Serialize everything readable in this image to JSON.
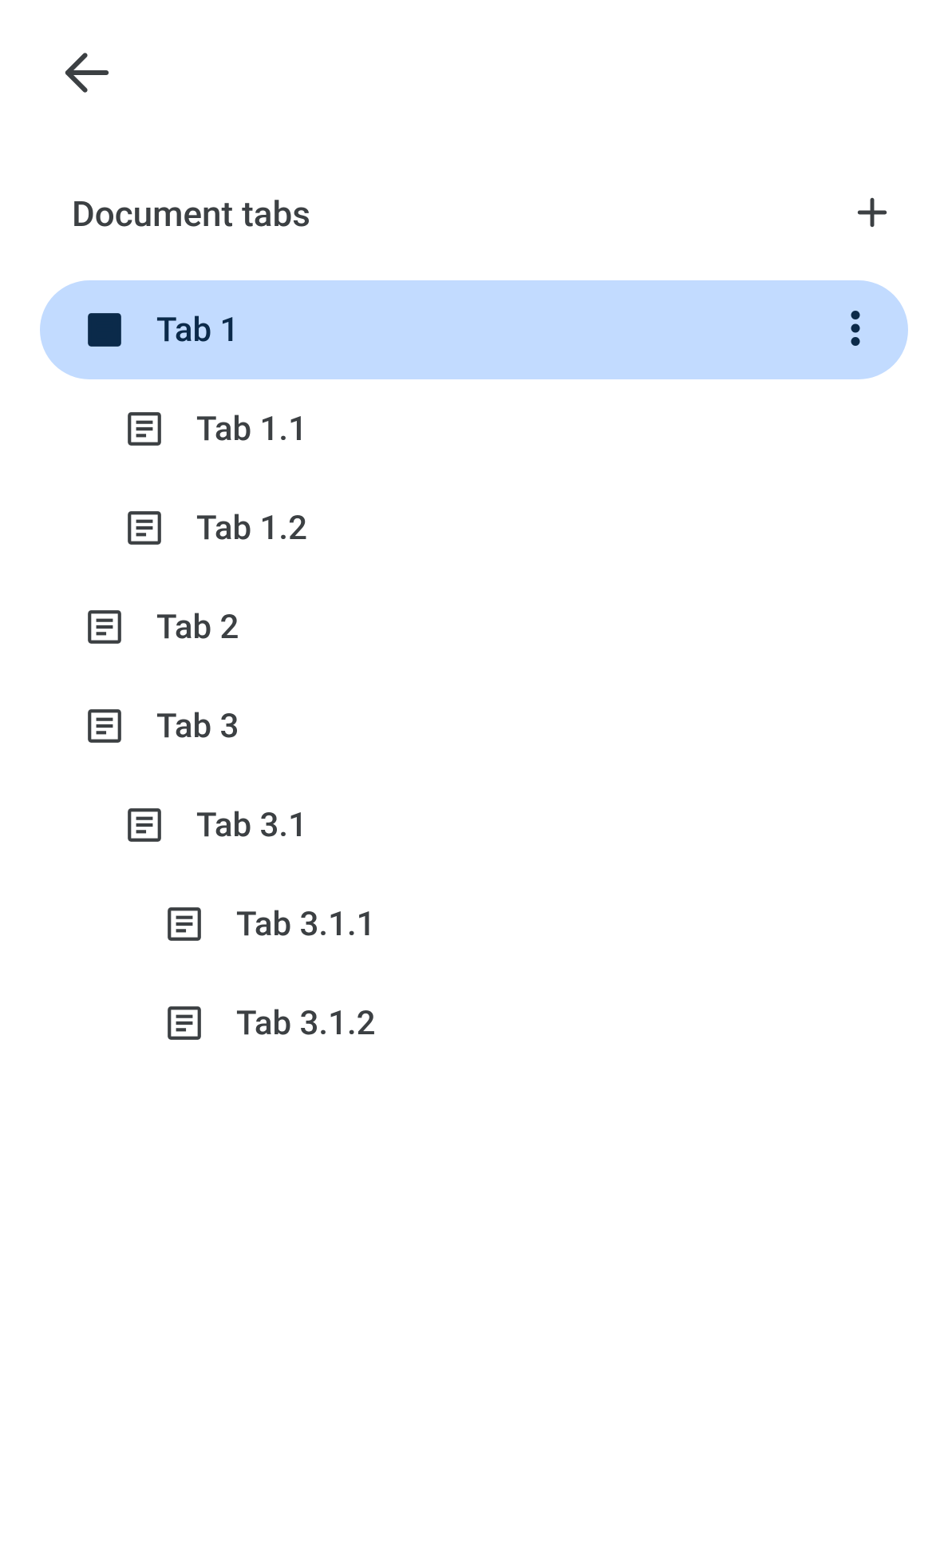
{
  "header": {
    "title": "Document tabs"
  },
  "tabs": [
    {
      "label": "Tab 1",
      "level": 0,
      "selected": true
    },
    {
      "label": "Tab 1.1",
      "level": 1,
      "selected": false
    },
    {
      "label": "Tab 1.2",
      "level": 1,
      "selected": false
    },
    {
      "label": "Tab 2",
      "level": 0,
      "selected": false
    },
    {
      "label": "Tab 3",
      "level": 0,
      "selected": false
    },
    {
      "label": "Tab 3.1",
      "level": 1,
      "selected": false
    },
    {
      "label": "Tab 3.1.1",
      "level": 2,
      "selected": false
    },
    {
      "label": "Tab 3.1.2",
      "level": 2,
      "selected": false
    }
  ],
  "colors": {
    "selected_bg": "#c2dbff",
    "text": "#3c4043",
    "selected_text": "#0b2a4a"
  }
}
